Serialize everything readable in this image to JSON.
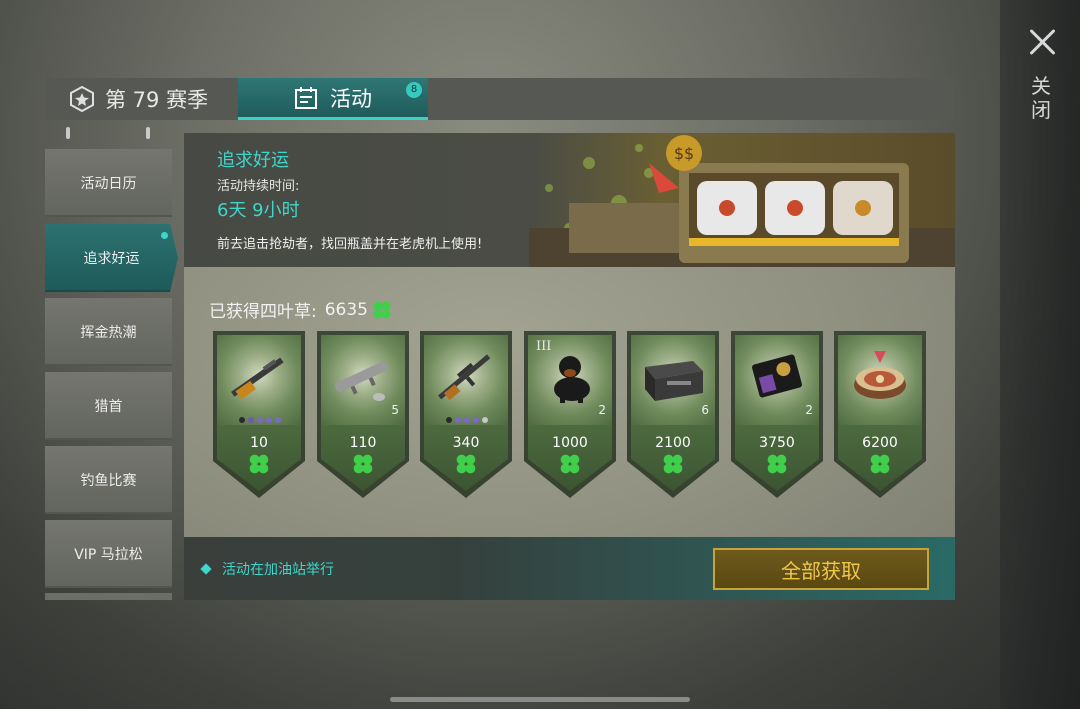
{
  "header": {
    "season_tab": "第 79 赛季",
    "activity_tab": "活动",
    "activity_badge": "8"
  },
  "close": {
    "label": "关闭"
  },
  "sidebar": {
    "items": [
      {
        "label": "活动日历",
        "active": false
      },
      {
        "label": "追求好运",
        "active": true
      },
      {
        "label": "挥金热潮",
        "active": false
      },
      {
        "label": "猎首",
        "active": false
      },
      {
        "label": "钓鱼比赛",
        "active": false
      },
      {
        "label": "VIP 马拉松",
        "active": false
      }
    ]
  },
  "banner": {
    "title": "追求好运",
    "duration_label": "活动持续时间:",
    "duration": "6天 9小时",
    "description": "前去追击抢劫者，找回瓶盖并在老虎机上使用!"
  },
  "clovers": {
    "label": "已获得四叶草:",
    "count": "6635"
  },
  "rewards": [
    {
      "name": "shotgun",
      "cost": "10",
      "qty": "",
      "tier": ""
    },
    {
      "name": "rocket-launcher",
      "cost": "110",
      "qty": "5",
      "tier": ""
    },
    {
      "name": "assault-rifle",
      "cost": "340",
      "qty": "",
      "tier": ""
    },
    {
      "name": "rottweiler-dog",
      "cost": "1000",
      "qty": "2",
      "tier": "III"
    },
    {
      "name": "weapon-crate",
      "cost": "2100",
      "qty": "6",
      "tier": ""
    },
    {
      "name": "badge-wallet",
      "cost": "3750",
      "qty": "2",
      "tier": ""
    },
    {
      "name": "roulette-wheel",
      "cost": "6200",
      "qty": "",
      "tier": ""
    }
  ],
  "footer": {
    "note": "活动在加油站举行",
    "claim_all": "全部获取"
  },
  "colors": {
    "accent": "#3fd6cc",
    "gold": "#f0c64a",
    "clover": "#3fcf4a"
  },
  "icons": [
    "season-emblem-icon",
    "calendar-icon",
    "close-icon",
    "clover-icon",
    "diamond-bullet-icon"
  ]
}
